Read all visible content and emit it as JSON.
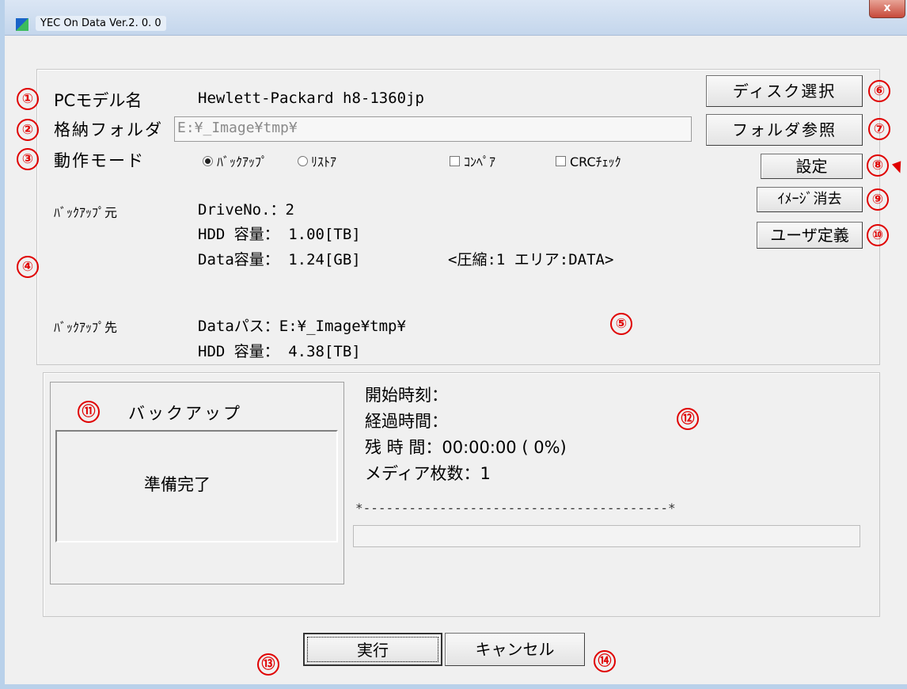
{
  "window": {
    "title": "YEC On Data Ver.2. 0. 0",
    "close_label": "x"
  },
  "markers": {
    "m1": "①",
    "m2": "②",
    "m3": "③",
    "m4": "④",
    "m5": "⑤",
    "m6": "⑥",
    "m7": "⑦",
    "m8": "⑧",
    "m9": "⑨",
    "m10": "⑩",
    "m11": "⑪",
    "m12": "⑫",
    "m13": "⑬",
    "m14": "⑭"
  },
  "settings": {
    "pc_model_label": "PCモデル名",
    "pc_model_value": "Hewlett-Packard h8-1360jp",
    "folder_label": "格納フォルダ",
    "folder_value": "E:¥_Image¥tmp¥",
    "mode_label": "動作モード",
    "mode_backup": "ﾊﾞｯｸｱｯﾌﾟ",
    "mode_restore": "ﾘｽﾄｱ",
    "compare_label": "ｺﾝﾍﾟｱ",
    "crc_label": "CRCﾁｪｯｸ",
    "mode_selected": "backup"
  },
  "source": {
    "label": "ﾊﾞｯｸｱｯﾌﾟ元",
    "drive": "DriveNo.：2",
    "hdd_capacity": "HDD 容量：  1.00[TB]",
    "data_capacity": "Data容量：  1.24[GB]",
    "compression": "<圧縮:1 エリア:DATA>"
  },
  "destination": {
    "label": "ﾊﾞｯｸｱｯﾌﾟ先",
    "data_path": "Dataパス：E:¥_Image¥tmp¥",
    "hdd_capacity": "HDD 容量：  4.38[TB]"
  },
  "buttons": {
    "disk_select": "ディスク選択",
    "folder_browse": "フォルダ参照",
    "settings": "設定",
    "image_delete": "ｲﾒｰｼﾞ消去",
    "user_define": "ユーザ定義",
    "execute": "実行",
    "cancel": "キャンセル"
  },
  "status": {
    "mode_title": "バックアップ",
    "state": "準備完了",
    "start_time": "開始時刻：",
    "elapsed": "経過時間：",
    "remaining": "残 時 間：00:00:00 (  0%)",
    "media_count": "メディア枚数：1",
    "progress_scale": "*----------------------------------------*",
    "progress": 0
  }
}
